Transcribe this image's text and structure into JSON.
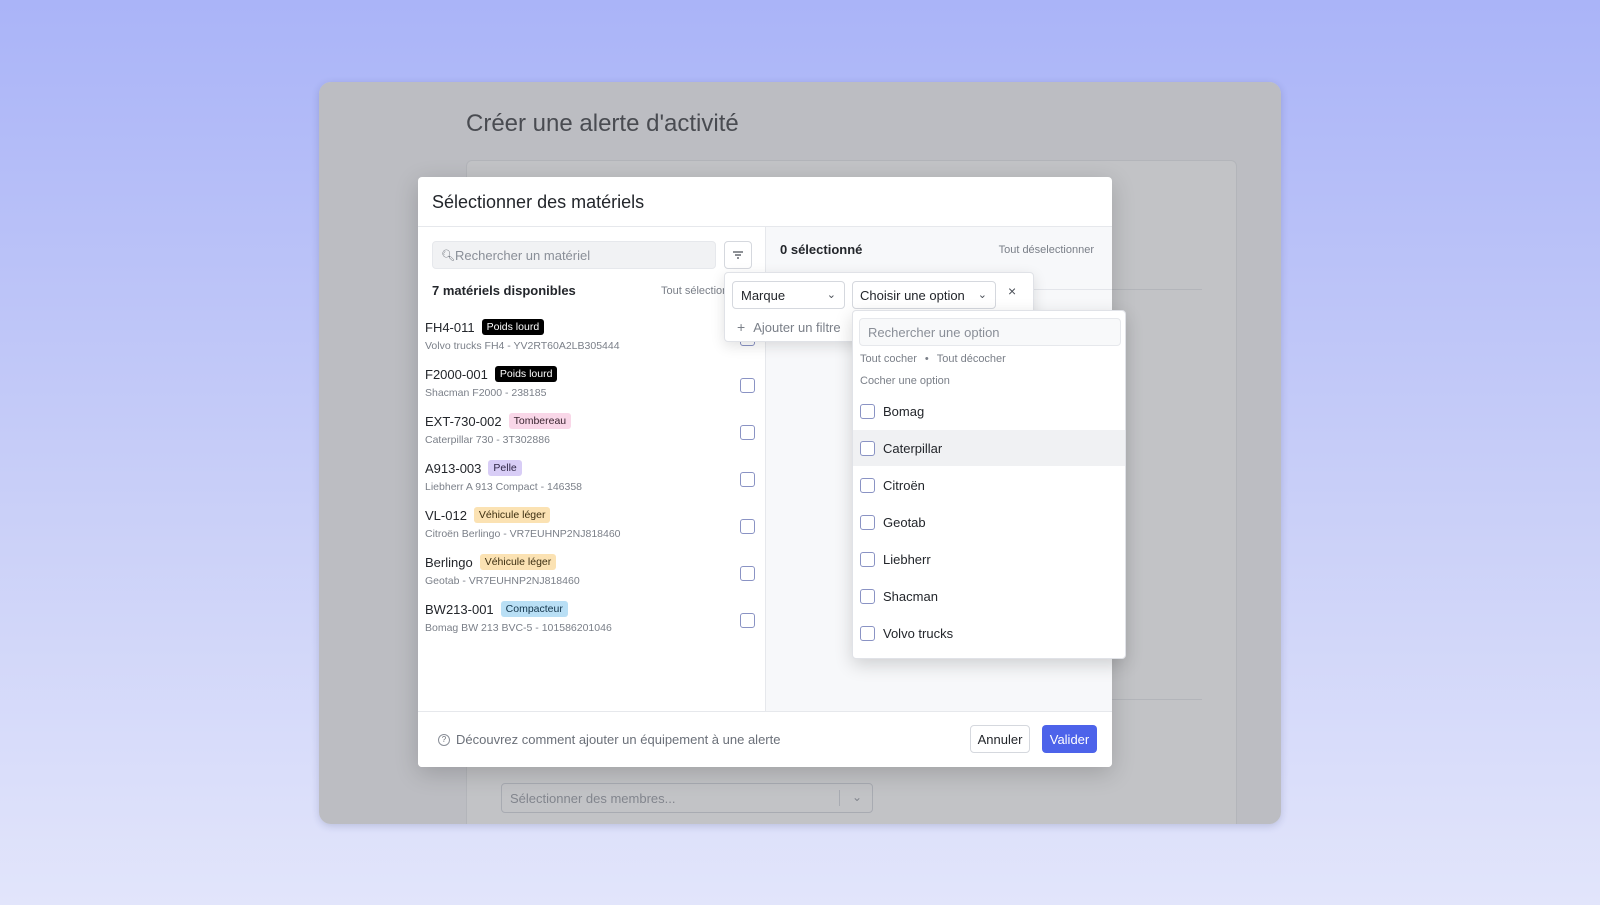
{
  "page": {
    "title": "Créer une alerte d'activité"
  },
  "background_form": {
    "members_select": {
      "placeholder": "Sélectionner des membres..."
    }
  },
  "modal": {
    "title": "Sélectionner des matériels",
    "search": {
      "placeholder": "Rechercher un matériel"
    },
    "available_count": "7 matériels disponibles",
    "select_all": "Tout sélectionner",
    "items": [
      {
        "name": "FH4-011",
        "tag": "Poids lourd",
        "tag_kind": "heavy",
        "sub": "Volvo trucks FH4 - YV2RT60A2LB305444"
      },
      {
        "name": "F2000-001",
        "tag": "Poids lourd",
        "tag_kind": "heavy",
        "sub": "Shacman F2000 - 238185"
      },
      {
        "name": "EXT-730-002",
        "tag": "Tombereau",
        "tag_kind": "tombereau",
        "sub": "Caterpillar 730 - 3T302886"
      },
      {
        "name": "A913-003",
        "tag": "Pelle",
        "tag_kind": "pelle",
        "sub": "Liebherr A 913 Compact - 146358"
      },
      {
        "name": "VL-012",
        "tag": "Véhicule léger",
        "tag_kind": "vl",
        "sub": "Citroën Berlingo - VR7EUHNP2NJ818460"
      },
      {
        "name": "Berlingo",
        "tag": "Véhicule léger",
        "tag_kind": "vl",
        "sub": "Geotab - VR7EUHNP2NJ818460"
      },
      {
        "name": "BW213-001",
        "tag": "Compacteur",
        "tag_kind": "compact",
        "sub": "Bomag BW 213 BVC-5 - 101586201046"
      }
    ],
    "selected_count": "0 sélectionné",
    "deselect_all": "Tout déselectionner",
    "footer": {
      "help": "Découvrez comment ajouter un équipement à une alerte",
      "cancel": "Annuler",
      "validate": "Valider"
    }
  },
  "filter": {
    "field": "Marque",
    "option_placeholder": "Choisir une option",
    "add_filter": "Ajouter un filtre",
    "dropdown": {
      "search_placeholder": "Rechercher une option",
      "check_all": "Tout cocher",
      "separator": "•",
      "uncheck_all": "Tout décocher",
      "hint": "Cocher une option",
      "options": [
        "Bomag",
        "Caterpillar",
        "Citroën",
        "Geotab",
        "Liebherr",
        "Shacman",
        "Volvo trucks"
      ],
      "hovered_index": 1
    }
  },
  "colors": {
    "accent": "#4d63ea"
  }
}
